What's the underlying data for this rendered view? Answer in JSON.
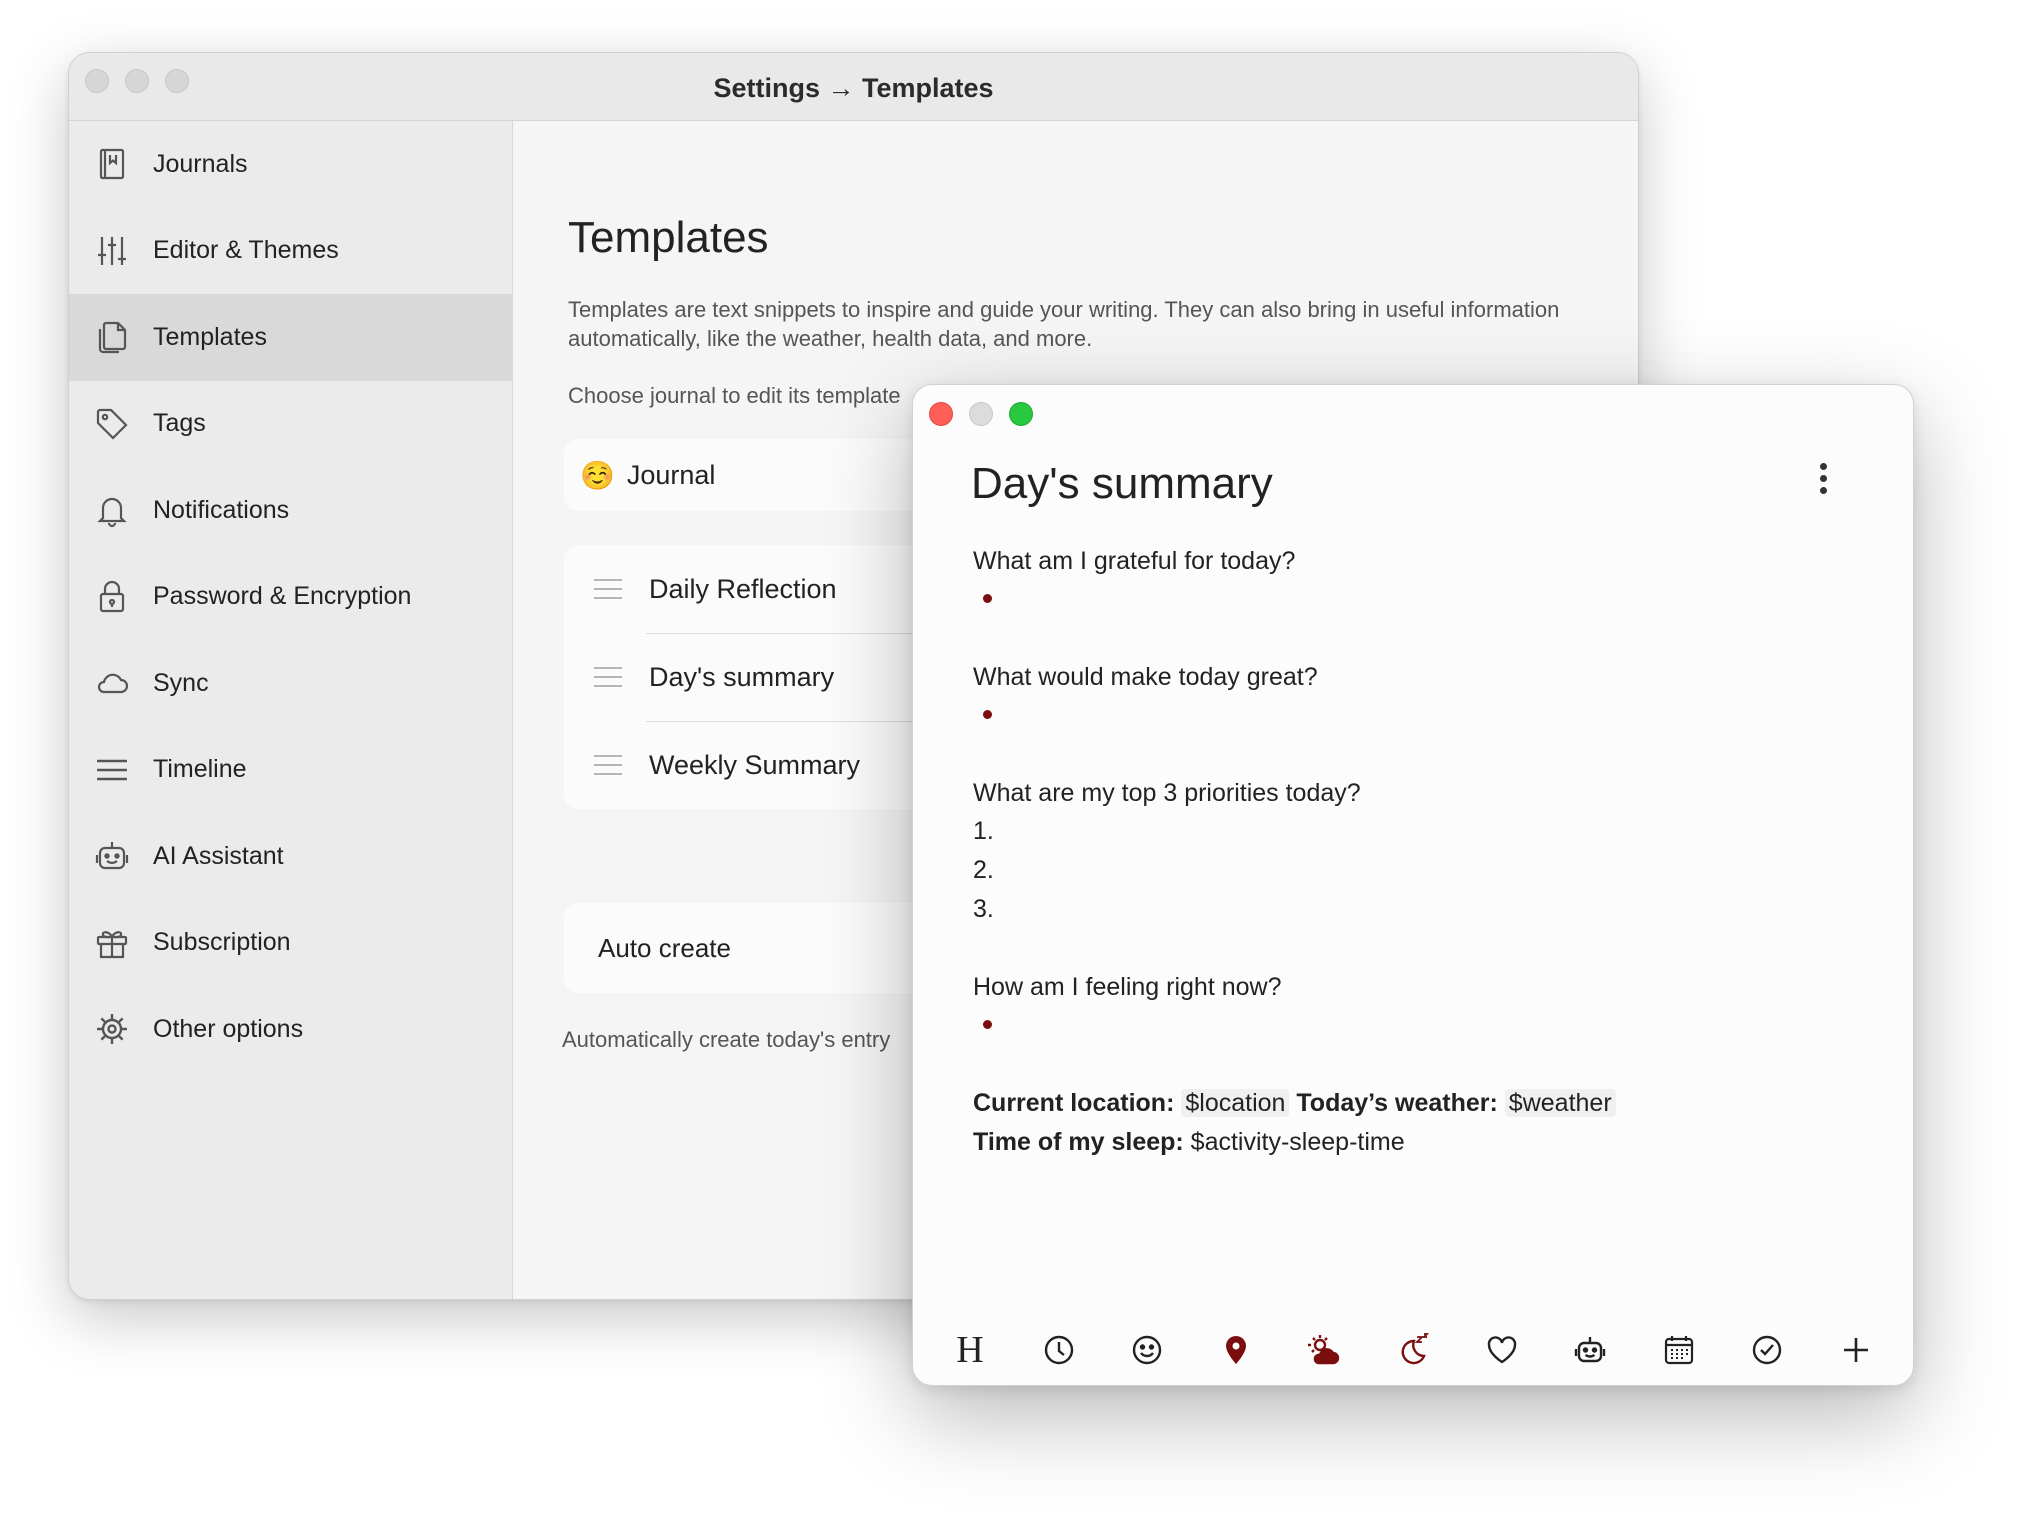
{
  "settings_window": {
    "title": "Settings → Templates",
    "sidebar": {
      "items": [
        {
          "label": "Journals",
          "icon": "journal-icon",
          "active": false
        },
        {
          "label": "Editor & Themes",
          "icon": "sliders-icon",
          "active": false
        },
        {
          "label": "Templates",
          "icon": "templates-icon",
          "active": true
        },
        {
          "label": "Tags",
          "icon": "tag-icon",
          "active": false
        },
        {
          "label": "Notifications",
          "icon": "bell-icon",
          "active": false
        },
        {
          "label": "Password & Encryption",
          "icon": "lock-icon",
          "active": false
        },
        {
          "label": "Sync",
          "icon": "cloud-icon",
          "active": false
        },
        {
          "label": "Timeline",
          "icon": "list-icon",
          "active": false
        },
        {
          "label": "AI Assistant",
          "icon": "robot-icon",
          "active": false
        },
        {
          "label": "Subscription",
          "icon": "gift-icon",
          "active": false
        },
        {
          "label": "Other options",
          "icon": "gear-icon",
          "active": false
        }
      ]
    },
    "main": {
      "heading": "Templates",
      "description": "Templates are text snippets to inspire and guide your writing. They can also bring in useful information automatically, like the weather, health data, and more.",
      "choose_label": "Choose journal to edit its template",
      "journal": {
        "emoji": "☺️",
        "name": "Journal"
      },
      "templates": [
        "Daily Reflection",
        "Day's summary",
        "Weekly Summary"
      ],
      "auto_create_label": "Auto create",
      "auto_create_hint": "Automatically create today's entry"
    }
  },
  "editor_window": {
    "title": "Day's summary",
    "questions": {
      "q1": "What am I grateful for today?",
      "q2": "What would make today great?",
      "q3": "What are my top 3 priorities today?",
      "q4": "How am I feeling right now?"
    },
    "numbers": [
      "1.",
      "2.",
      "3."
    ],
    "variables": {
      "location_label": "Current location:",
      "location_value": "$location",
      "weather_label": "Today’s weather:",
      "weather_value": "$weather",
      "sleep_label": "Time of my sleep:",
      "sleep_value": "$activity-sleep-time"
    },
    "toolbar": {
      "heading_label": "H",
      "icons": [
        "heading-icon",
        "clock-icon",
        "smiley-icon",
        "location-pin-icon",
        "weather-icon",
        "sleep-icon",
        "heart-icon",
        "robot-icon",
        "calendar-icon",
        "checkmark-icon",
        "plus-icon"
      ]
    },
    "accent_color": "#7a0d0d"
  }
}
